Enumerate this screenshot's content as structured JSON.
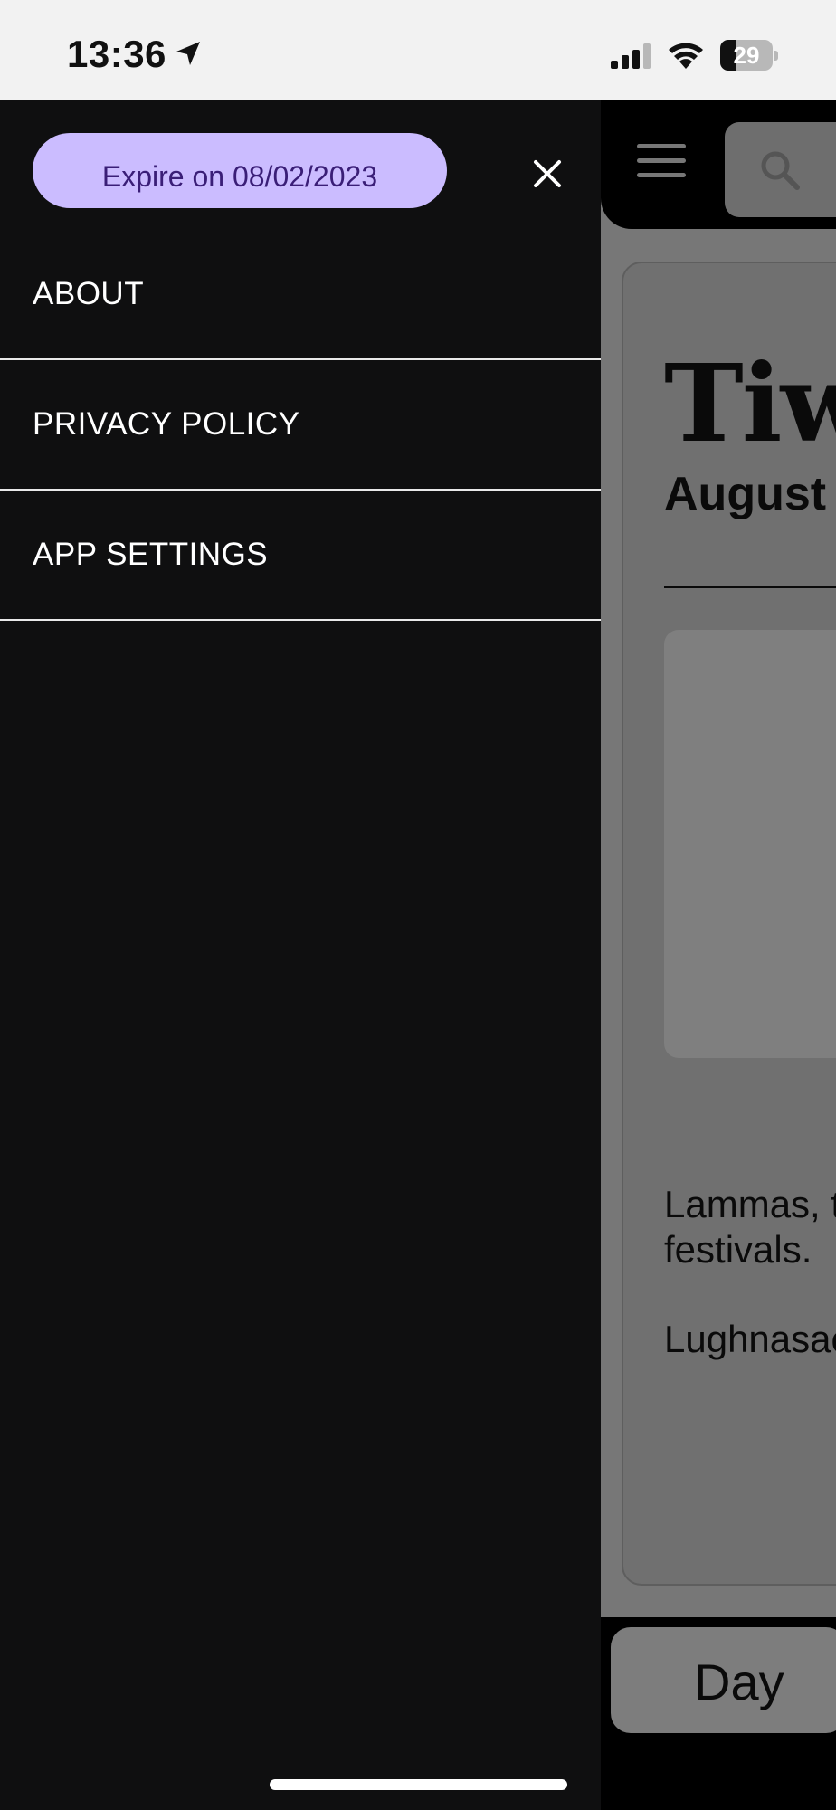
{
  "status_bar": {
    "time": "13:36",
    "battery": "29",
    "battery_level": 0.29,
    "icons": [
      "location-arrow-icon",
      "cellular-signal-icon",
      "wifi-icon",
      "battery-icon"
    ]
  },
  "drawer": {
    "expire_label": "Expire on 08/02/2023",
    "close_icon": "close-icon",
    "pill_color": "#cbbcff",
    "background_color": "#0f0f10",
    "menu_items": [
      {
        "label": "ABOUT"
      },
      {
        "label": "PRIVACY POLICY"
      },
      {
        "label": "APP SETTINGS"
      }
    ]
  },
  "background_app": {
    "header_icons": [
      "hamburger-menu-icon",
      "search-icon"
    ],
    "masthead": "Tiw",
    "date": "August",
    "body_text_1": "Lammas, t festivals.",
    "body_text_2": "Lughnasac",
    "tab_label": "Day"
  }
}
